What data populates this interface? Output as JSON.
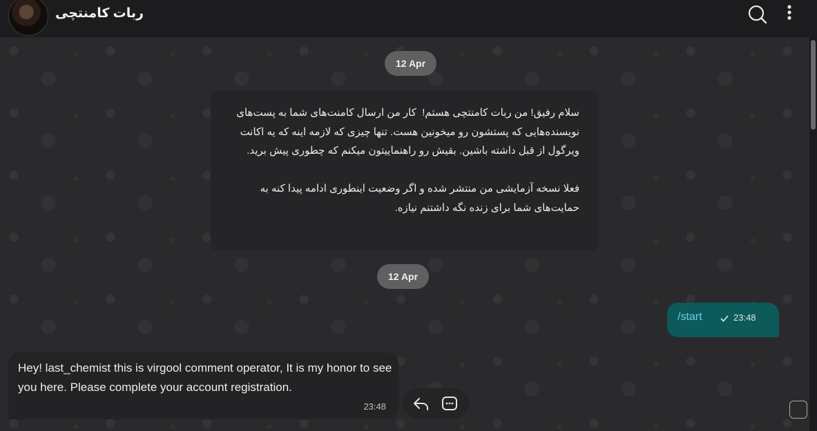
{
  "header": {
    "title": "ربات کامنتچی"
  },
  "dates": [
    "12 Apr",
    "12 Apr"
  ],
  "messages": {
    "intro": "سلام رفیق! من ربات کامنتچی هستم!  کار من ارسال کامنت‌های شما به پست‌های نویسنده‌هایی که پستشون رو میخونین هست. تنها چیزی که لازمه اینه که یه اکانت ویرگول از قبل داشته باشین. بقیش رو راهنماییتون میکنم که چطوری پیش برید.\n\nفعلا نسخه آزمایشی من منتشر شده و اگر وضعیت اینطوری ادامه پیدا کنه به حمایت‌های شما برای زنده نگه داشتنم نیازه.",
    "outgoing": {
      "text": "/start",
      "time": "23:48"
    },
    "bot_reply": {
      "text": "Hey! last_chemist this is virgool comment operator, It is my honor to see you here. Please complete your account registration.",
      "time": "23:48"
    }
  },
  "icons": {
    "search": "search-icon",
    "more": "more-vertical-icon",
    "reply": "reply-icon",
    "keyboard": "keyboard-icon",
    "check": "check-icon"
  },
  "colors": {
    "outgoing_bubble": "#0d5a5b",
    "incoming_bubble": "#252527",
    "header": "#1c1c1e",
    "command_link": "#6fd0e6"
  }
}
